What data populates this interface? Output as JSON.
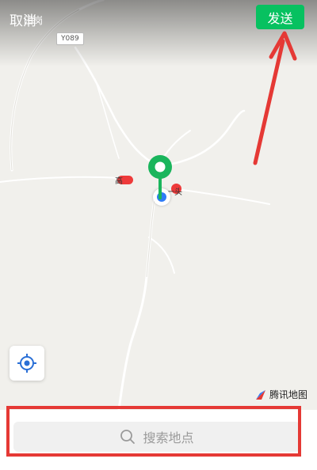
{
  "header": {
    "cancel_label": "取消",
    "send_label": "发送"
  },
  "map": {
    "place_label": "田岗",
    "road_label": "Y089",
    "poi_left_label": "高",
    "poi_right_label": "一头",
    "provider_label": "腾讯地图"
  },
  "search": {
    "placeholder": "搜索地点"
  },
  "colors": {
    "accent_green": "#07c160",
    "annotation_red": "#e53935",
    "pin_green": "#1ab55c",
    "current_location_blue": "#2f7cf6"
  },
  "icons": {
    "search": "search-icon",
    "locate": "crosshair-icon",
    "pin": "map-pin-icon",
    "logo": "tencent-map-logo"
  }
}
